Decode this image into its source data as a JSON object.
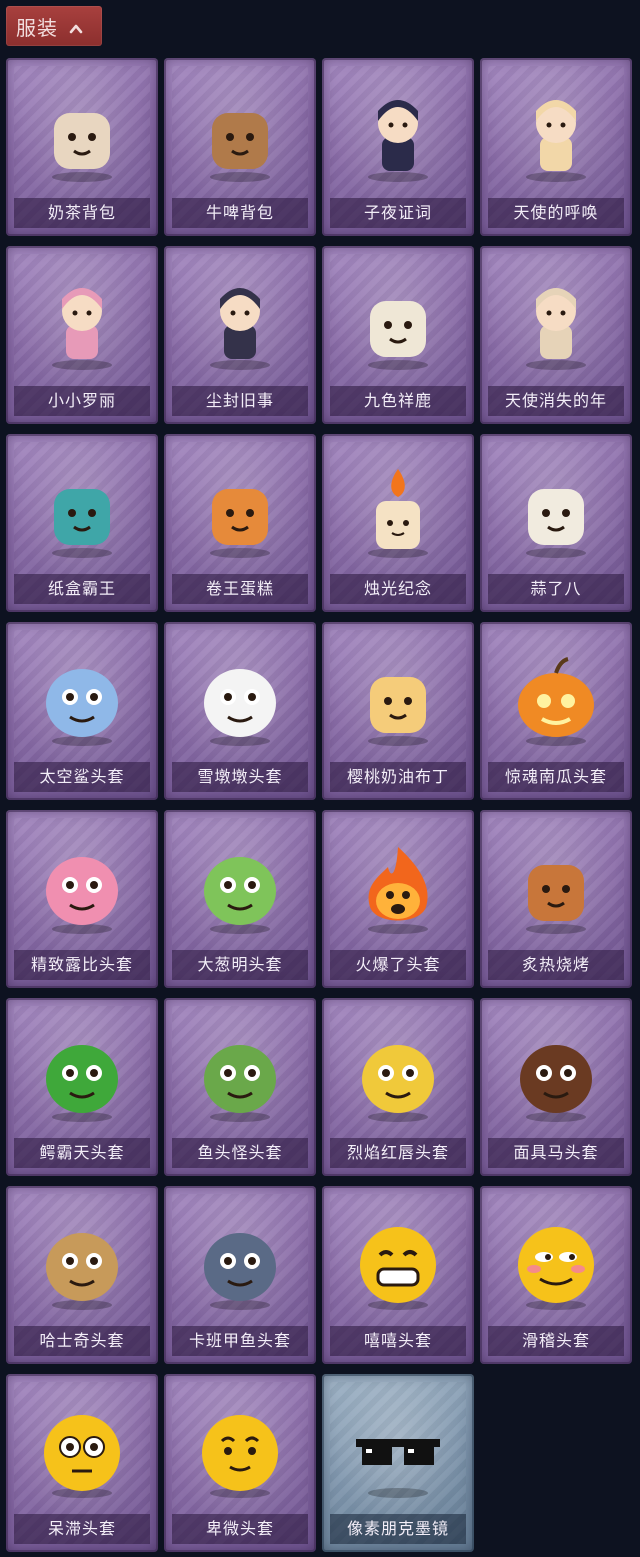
{
  "category": {
    "label": "服装",
    "expanded": true
  },
  "items": [
    {
      "name": "奶茶背包",
      "icon": "milk-tea-backpack-icon",
      "color": "#e8d6c0",
      "tier": "purple"
    },
    {
      "name": "牛啤背包",
      "icon": "beer-cow-backpack-icon",
      "color": "#b07a4a",
      "tier": "purple"
    },
    {
      "name": "子夜证词",
      "icon": "crow-mask-figure-icon",
      "color": "#2b2b4a",
      "tier": "purple"
    },
    {
      "name": "天使的呼唤",
      "icon": "angel-doll-icon",
      "color": "#f2d7a8",
      "tier": "purple"
    },
    {
      "name": "小小罗丽",
      "icon": "pink-princess-doll-icon",
      "color": "#e79ab8",
      "tier": "purple"
    },
    {
      "name": "尘封旧事",
      "icon": "dark-hair-doll-icon",
      "color": "#34324a",
      "tier": "purple"
    },
    {
      "name": "九色祥鹿",
      "icon": "white-deer-icon",
      "color": "#efe7d6",
      "tier": "purple"
    },
    {
      "name": "天使消失的年",
      "icon": "veiled-angel-doll-icon",
      "color": "#e6d3b8",
      "tier": "purple"
    },
    {
      "name": "纸盒霸王",
      "icon": "cardboard-dino-icon",
      "color": "#3fa6a8",
      "tier": "purple"
    },
    {
      "name": "卷王蛋糕",
      "icon": "roll-cake-icon",
      "color": "#e68a3a",
      "tier": "purple"
    },
    {
      "name": "烛光纪念",
      "icon": "candle-icon",
      "color": "#f5e2c4",
      "tier": "purple"
    },
    {
      "name": "蒜了八",
      "icon": "garlic-icon",
      "color": "#f1ebdf",
      "tier": "purple"
    },
    {
      "name": "太空鲨头套",
      "icon": "shark-head-icon",
      "color": "#8fb8e8",
      "tier": "purple"
    },
    {
      "name": "雪墩墩头套",
      "icon": "snowman-head-icon",
      "color": "#f4f4f4",
      "tier": "purple"
    },
    {
      "name": "樱桃奶油布丁",
      "icon": "pudding-icon",
      "color": "#f5cc7a",
      "tier": "purple"
    },
    {
      "name": "惊魂南瓜头套",
      "icon": "pumpkin-head-icon",
      "color": "#f08a24",
      "tier": "purple"
    },
    {
      "name": "精致露比头套",
      "icon": "pink-beaver-head-icon",
      "color": "#f08fb0",
      "tier": "purple"
    },
    {
      "name": "大葱明头套",
      "icon": "scallion-head-icon",
      "color": "#7fc45a",
      "tier": "purple"
    },
    {
      "name": "火爆了头套",
      "icon": "fire-head-icon",
      "color": "#f2661c",
      "tier": "purple"
    },
    {
      "name": "炙热烧烤",
      "icon": "bbq-meat-icon",
      "color": "#c8763a",
      "tier": "purple"
    },
    {
      "name": "鳄霸天头套",
      "icon": "crocodile-head-icon",
      "color": "#3fa83a",
      "tier": "purple"
    },
    {
      "name": "鱼头怪头套",
      "icon": "fish-head-icon",
      "color": "#6aa84a",
      "tier": "purple"
    },
    {
      "name": "烈焰红唇头套",
      "icon": "yellow-mouse-head-icon",
      "color": "#f0c93a",
      "tier": "purple"
    },
    {
      "name": "面具马头套",
      "icon": "horse-head-icon",
      "color": "#6a3a22",
      "tier": "purple"
    },
    {
      "name": "哈士奇头套",
      "icon": "husky-head-icon",
      "color": "#c79a5a",
      "tier": "purple"
    },
    {
      "name": "卡班甲鱼头套",
      "icon": "whale-head-icon",
      "color": "#5a6a86",
      "tier": "purple"
    },
    {
      "name": "嘻嘻头套",
      "icon": "grin-emoji-head-icon",
      "color": "#f6c21a",
      "tier": "purple"
    },
    {
      "name": "滑稽头套",
      "icon": "funny-emoji-head-icon",
      "color": "#f6c21a",
      "tier": "purple"
    },
    {
      "name": "呆滞头套",
      "icon": "dazed-emoji-head-icon",
      "color": "#f6c21a",
      "tier": "purple"
    },
    {
      "name": "卑微头套",
      "icon": "humble-emoji-head-icon",
      "color": "#f6c21a",
      "tier": "purple"
    },
    {
      "name": "像素朋克墨镜",
      "icon": "pixel-sunglasses-icon",
      "color": "#111111",
      "tier": "blue"
    }
  ]
}
